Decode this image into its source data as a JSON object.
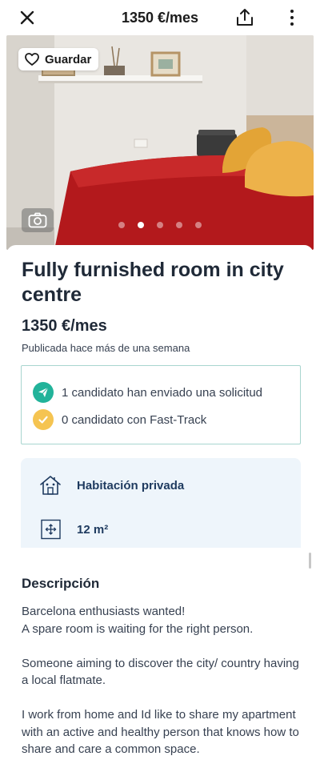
{
  "header": {
    "price_title": "1350 €/mes"
  },
  "gallery": {
    "save_label": "Guardar",
    "photo_count": 5,
    "active_photo_index": 1
  },
  "listing": {
    "title": "Fully furnished room in city centre",
    "price": "1350 €/mes",
    "published": "Publicada hace más de una semana"
  },
  "applicants": {
    "submitted": "1 candidato han enviado una solicitud",
    "fast_track": "0 candidato con Fast-Track",
    "submitted_icon_color": "#22b39a",
    "fast_track_icon_color": "#f5c451"
  },
  "features": [
    {
      "icon": "house-icon",
      "label": "Habitación privada"
    },
    {
      "icon": "area-icon",
      "label": "12 m²"
    }
  ],
  "description": {
    "heading": "Descripción",
    "paragraphs": [
      "Barcelona enthusiasts wanted!\nA spare room is waiting for the right person.",
      "Someone aiming to discover the city/ country having a local flatmate.",
      "I work from home and Id like to share my apartment with an active and healthy person that knows how to share and care a common space."
    ]
  },
  "colors": {
    "accent_teal": "#a8d5cf",
    "feature_bg": "#eef5fb",
    "feature_text": "#1e3a5f"
  }
}
